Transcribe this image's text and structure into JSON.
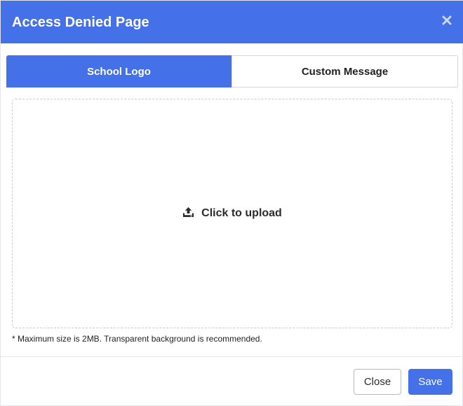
{
  "dialog": {
    "title": "Access Denied Page"
  },
  "tabs": [
    {
      "label": "School Logo",
      "active": true
    },
    {
      "label": "Custom Message",
      "active": false
    }
  ],
  "upload": {
    "label": "Click to upload",
    "icon": "upload-icon",
    "hint": "* Maximum size is 2MB. Transparent background is recommended."
  },
  "footer": {
    "close_label": "Close",
    "save_label": "Save"
  },
  "colors": {
    "primary": "#4470e8",
    "header_text": "#ffffff",
    "border": "#d5d8dc"
  }
}
